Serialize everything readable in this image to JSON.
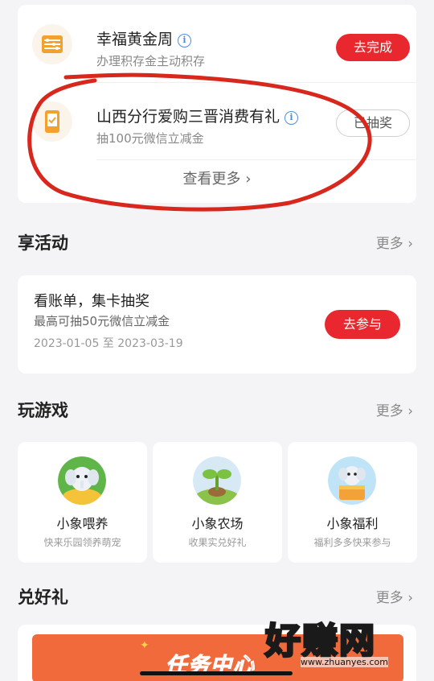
{
  "tasks": [
    {
      "icon": "abacus-icon",
      "title": "幸福黄金周",
      "subtitle": "办理积存金主动积存",
      "button": "去完成",
      "button_style": "primary"
    },
    {
      "icon": "phone-coupon-icon",
      "title": "山西分行爱购三晋消费有礼",
      "subtitle": "抽100元微信立减金",
      "button": "已抽奖",
      "button_style": "secondary"
    }
  ],
  "tasks_more": "查看更多",
  "activities": {
    "title": "享活动",
    "more": "更多",
    "item": {
      "title": "看账单，集卡抽奖",
      "subtitle": "最高可抽50元微信立减金",
      "date_range": "2023-01-05 至 2023-03-19",
      "button": "去参与"
    }
  },
  "games": {
    "title": "玩游戏",
    "more": "更多",
    "items": [
      {
        "name": "小象喂养",
        "subtitle": "快来乐园领养萌宠",
        "icon": "elephant-feeding-icon"
      },
      {
        "name": "小象农场",
        "subtitle": "收果实兑好礼",
        "icon": "farm-sprout-icon"
      },
      {
        "name": "小象福利",
        "subtitle": "福利多多快来参与",
        "icon": "elephant-gift-icon"
      }
    ]
  },
  "gifts": {
    "title": "兑好礼",
    "more": "更多",
    "banner_text": "任务中心"
  },
  "watermark": {
    "text": "好赚网",
    "url": "www.zhuanyes.com"
  },
  "colors": {
    "accent_red": "#e8282e",
    "annotation_red": "#d8281e",
    "info_blue": "#4a90d9",
    "banner_orange": "#f06a3c"
  }
}
